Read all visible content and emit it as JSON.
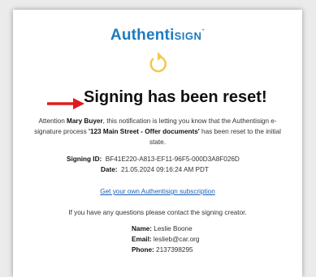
{
  "logo": {
    "main": "Authenti",
    "accent": "SIGN",
    "mark": "+"
  },
  "headline": "Signing has been reset!",
  "message": {
    "prefix": "Attention ",
    "recipient": "Mary Buyer",
    "middle": ", this notification is letting you know that the Authentisign e-signature process ",
    "process_name": "'123 Main Street - Offer documents'",
    "suffix": " has been reset to the initial state."
  },
  "signing": {
    "id_label": "Signing ID:",
    "id_value": "BF41E220-A813-EF11-96F5-000D3A8F026D",
    "date_label": "Date:",
    "date_value": "21.05.2024 09:16:24 AM PDT"
  },
  "subscription_link": "Get your own Authentisign subscription",
  "contact_prompt": "If you have any questions please contact the signing creator.",
  "creator": {
    "name_label": "Name:",
    "name_value": "Leslie Boone",
    "email_label": "Email:",
    "email_value": "leslieb@car.org",
    "phone_label": "Phone:",
    "phone_value": "2137398295"
  },
  "colors": {
    "brand_blue": "#1e7bbf",
    "accent_yellow": "#f2c94c",
    "arrow_red": "#e01b1b",
    "link": "#1a5fb4"
  },
  "icons": {
    "reset": "reset-arrow-icon",
    "pointer": "red-arrow-icon"
  }
}
